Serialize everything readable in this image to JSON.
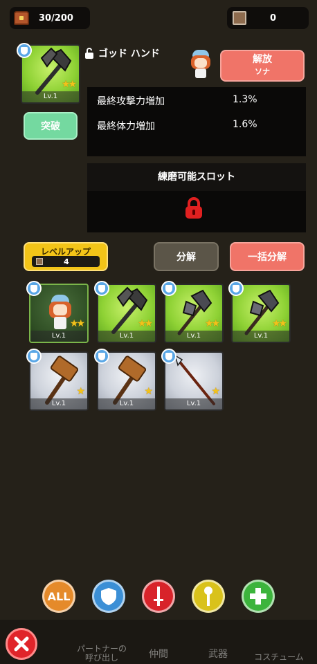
{
  "top": {
    "inventory_count": "30/200",
    "chest_icon": "treasure-chest-icon",
    "material_count": "0",
    "material_icon": "material-crate-icon"
  },
  "selected": {
    "name": "ゴッド ハンド",
    "level": "Lv.1",
    "lock_icon": "unlock-icon",
    "release_label": "解放",
    "release_sub": "ソナ",
    "breakthrough_label": "突破",
    "stats": [
      {
        "label": "最終攻撃力増加",
        "value": "1.3%"
      },
      {
        "label": "最終体力増加",
        "value": "1.6%"
      }
    ],
    "slot_title": "練磨可能スロット",
    "slot_icon": "padlock-icon"
  },
  "actions": {
    "levelup_label": "レベルアップ",
    "levelup_count": "4",
    "disassemble_label": "分解",
    "bulk_disassemble_label": "一括分解"
  },
  "items": [
    {
      "level": "Lv.1",
      "stars": "★★",
      "type": "character",
      "bg": "selected"
    },
    {
      "level": "Lv.1",
      "stars": "★★",
      "type": "axe",
      "bg": "green"
    },
    {
      "level": "Lv.1",
      "stars": "★★",
      "type": "dark-axe",
      "bg": "green"
    },
    {
      "level": "Lv.1",
      "stars": "★★",
      "type": "dark-axe",
      "bg": "green"
    },
    {
      "level": "Lv.1",
      "stars": "★",
      "type": "hammer",
      "bg": "grey"
    },
    {
      "level": "Lv.1",
      "stars": "★",
      "type": "hammer",
      "bg": "grey"
    },
    {
      "level": "Lv.1",
      "stars": "★",
      "type": "spear",
      "bg": "grey"
    }
  ],
  "filters": [
    {
      "label": "ALL",
      "color": "#e58a2a"
    },
    {
      "icon": "shield-icon",
      "color": "#3b8fd6"
    },
    {
      "icon": "sword-icon",
      "color": "#d8232a"
    },
    {
      "icon": "staff-icon",
      "color": "#d9c21b"
    },
    {
      "icon": "heal-cross-icon",
      "color": "#3cb43c"
    }
  ],
  "nav": {
    "close_icon": "close-icon",
    "tabs": [
      {
        "label_line1": "パートナーの",
        "label_line2": "呼び出し"
      },
      {
        "label_line1": "仲間",
        "label_line2": ""
      },
      {
        "label_line1": "武器",
        "label_line2": ""
      },
      {
        "label_line1": "コスチューム",
        "label_line2": ""
      }
    ]
  }
}
